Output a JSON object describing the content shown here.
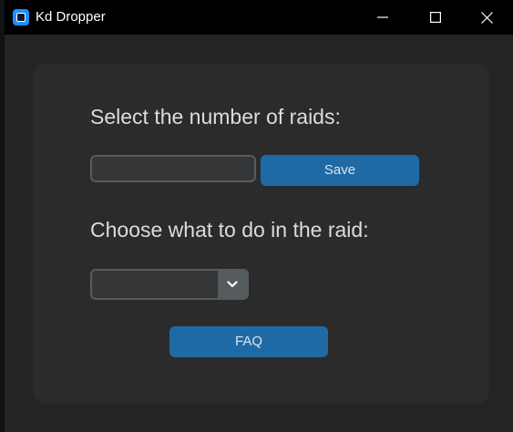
{
  "window": {
    "title": "Kd Dropper"
  },
  "icons": {
    "app": "app-icon",
    "minimize": "minimize-icon",
    "maximize": "maximize-icon",
    "close": "close-icon",
    "dropdown": "chevron-down-icon"
  },
  "colors": {
    "titlebar": "#000000",
    "window_background": "#242424",
    "panel_background": "#2b2b2b",
    "accent_button": "#1f6aa5",
    "app_icon": "#1e90ff"
  },
  "main": {
    "raids_label": "Select the number of raids:",
    "raids_input": {
      "value": "",
      "placeholder": ""
    },
    "save_label": "Save",
    "action_label": "Choose what to do in the raid:",
    "action_select": {
      "selected": ""
    },
    "faq_label": "FAQ"
  }
}
